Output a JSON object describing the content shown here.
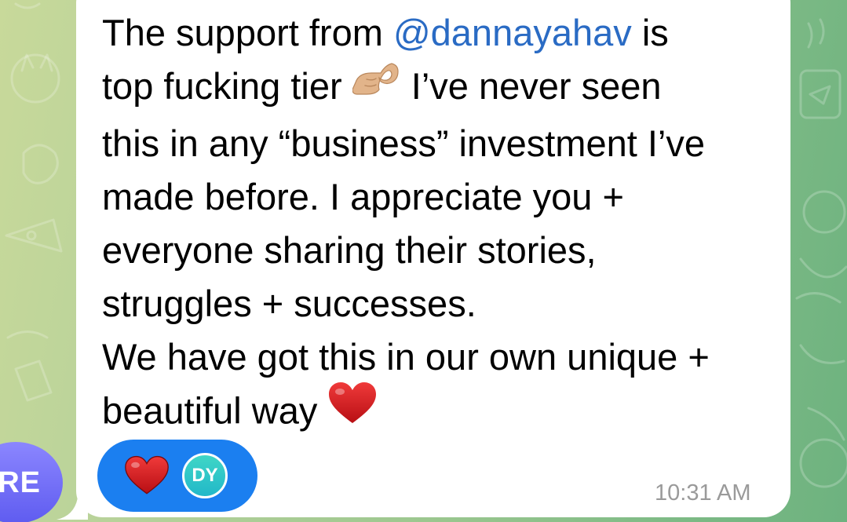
{
  "sender_avatar": {
    "initials": "RE",
    "color": "#6b67f7"
  },
  "message": {
    "lines": [
      {
        "before": "The support from ",
        "mention": "@dannayahav",
        "after": " is"
      },
      {
        "before": "top fucking tier ",
        "emoji": "ok-hand-emoji",
        "after": " I’ve never seen"
      },
      {
        "text": "this in any “business” investment I’ve"
      },
      {
        "text": "made before. I appreciate you +"
      },
      {
        "text": "everyone sharing their stories,"
      },
      {
        "text": "struggles + successes."
      },
      {
        "text": "We have got this in our own unique +"
      },
      {
        "before": "beautiful way",
        "emoji": "red-heart-emoji"
      }
    ],
    "mention_color": "#2a6bc4",
    "timestamp": "10:31 AM"
  },
  "reactions": [
    {
      "emoji": "red-heart-emoji",
      "reactor_initials": "DY",
      "pill_color": "#1b7ff0",
      "reactor_color": "#2ec8c8"
    }
  ],
  "colors": {
    "bubble": "#ffffff",
    "wallpaper": "#9cc78f",
    "timestamp": "#9a9a9a"
  }
}
